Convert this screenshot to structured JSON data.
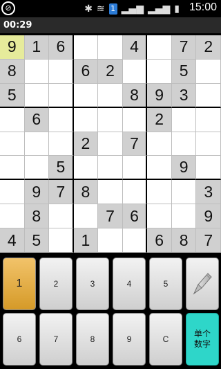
{
  "status_bar": {
    "time": "15:00",
    "badge": "1"
  },
  "timer": "00:29",
  "board": {
    "rows": [
      [
        "9",
        "1",
        "6",
        "",
        "",
        "4",
        "",
        "7",
        "2"
      ],
      [
        "8",
        "",
        "",
        "6",
        "2",
        "",
        "",
        "5",
        ""
      ],
      [
        "5",
        "",
        "",
        "",
        "",
        "8",
        "9",
        "3",
        ""
      ],
      [
        "",
        "6",
        "",
        "",
        "",
        "",
        "2",
        "",
        ""
      ],
      [
        "",
        "",
        "",
        "2",
        "",
        "7",
        "",
        "",
        ""
      ],
      [
        "",
        "",
        "5",
        "",
        "",
        "",
        "",
        "9",
        ""
      ],
      [
        "",
        "9",
        "7",
        "8",
        "",
        "",
        "",
        "",
        "3"
      ],
      [
        "",
        "8",
        "",
        "",
        "7",
        "6",
        "",
        "",
        "9"
      ],
      [
        "4",
        "5",
        "",
        "1",
        "",
        "",
        "6",
        "8",
        "7"
      ]
    ],
    "selected": [
      0,
      0
    ]
  },
  "keypad": {
    "row1": [
      "1",
      "2",
      "3",
      "4",
      "5"
    ],
    "row2": [
      "6",
      "7",
      "8",
      "9",
      "C"
    ],
    "mode_label_line1": "单个",
    "mode_label_line2": "数字",
    "active_key": "1"
  }
}
